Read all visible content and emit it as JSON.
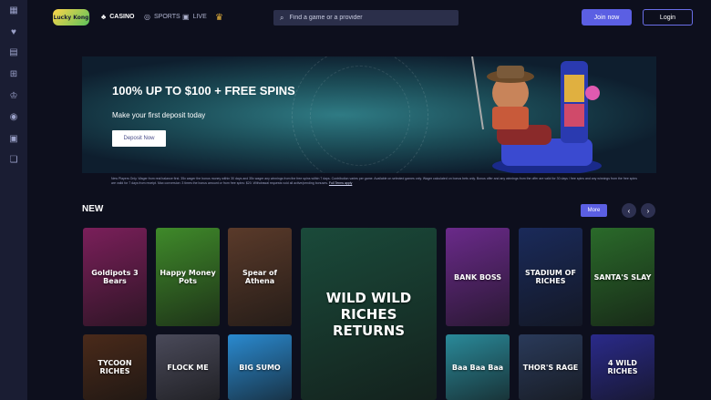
{
  "header": {
    "logo": "Lucky Kong",
    "nav": [
      {
        "label": "CASINO",
        "icon": "casino-icon"
      },
      {
        "label": "SPORTS",
        "icon": "sports-icon"
      },
      {
        "label": "LIVE",
        "icon": "live-icon"
      }
    ],
    "search_placeholder": "Find a game or a provider",
    "join_label": "Join now",
    "login_label": "Login"
  },
  "sidebar": {
    "icons": [
      "grid-icon",
      "heart-icon",
      "receipt-icon",
      "gift-icon",
      "trophy-icon",
      "chip-icon",
      "tiles-icon",
      "chat-icon"
    ]
  },
  "banner": {
    "title": "100% UP TO $100 + FREE SPINS",
    "subtitle": "Make your first deposit today",
    "cta": "Deposit Now",
    "terms": "New Players Only. Wager from real balance first. 35x wager the bonus money within 30 days and 35x wager any winnings from the free spins within 7 days. Contribution varies per game. Available on selected games only. Wager calculated on bonus bets only. Bonus offer and any winnings from the offer are valid for 30 days / free spins and any winnings from the free spins are valid for 7 days from receipt. Max conversion: 3 times the bonus amount or from free spins: $20. Withdrawal requests void all active/pending bonuses.",
    "terms_link": "Full Terms apply"
  },
  "section": {
    "title": "NEW",
    "more_label": "More",
    "prev": "‹",
    "next": "›"
  },
  "games": [
    {
      "name": "Goldipots 3 Bears",
      "color": "#7a1f5a"
    },
    {
      "name": "Happy Money Pots",
      "color": "#3f8a2a"
    },
    {
      "name": "Spear of Athena",
      "color": "#5a3a2a"
    },
    {
      "name": "WILD WILD RICHES RETURNS",
      "color": "#1a4a3a"
    },
    {
      "name": "BANK BOSS",
      "color": "#6a2a8a"
    },
    {
      "name": "STADIUM OF RICHES",
      "color": "#1a2a5a"
    },
    {
      "name": "SANTA'S SLAY",
      "color": "#2a6a2a"
    },
    {
      "name": "TYCOON RICHES",
      "color": "#4a2a1a"
    },
    {
      "name": "FLOCK ME",
      "color": "#4a4a5a"
    },
    {
      "name": "BIG SUMO",
      "color": "#2a8ad0"
    },
    {
      "name": "Baa Baa Baa",
      "color": "#2a8a9a"
    },
    {
      "name": "THOR'S RAGE",
      "color": "#2a3a5a"
    },
    {
      "name": "4 WILD RICHES",
      "color": "#2a2a8a"
    }
  ]
}
